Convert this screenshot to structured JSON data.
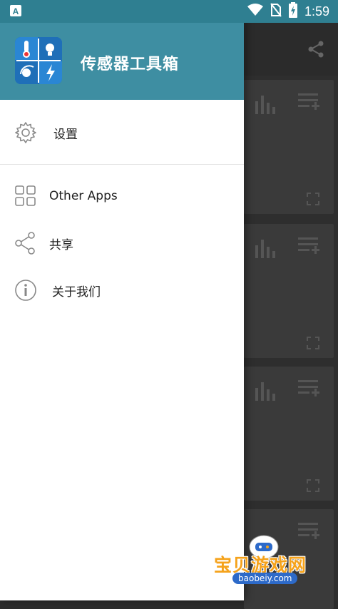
{
  "status_bar": {
    "time": "1:59",
    "icons": [
      "notification-a-icon",
      "wifi-icon",
      "no-sim-icon",
      "battery-charging-icon"
    ]
  },
  "drawer": {
    "app_title": "传感器工具箱",
    "menu": [
      {
        "label": "设置",
        "icon": "gear-icon"
      },
      {
        "label": "Other Apps",
        "icon": "grid-icon"
      },
      {
        "label": "共享",
        "icon": "share-icon"
      },
      {
        "label": "关于我们",
        "icon": "info-icon"
      }
    ]
  },
  "background_app": {
    "toolbar_icon": "share-icon",
    "card_icons": [
      "bar-chart-icon",
      "playlist-add-icon",
      "fullscreen-icon"
    ]
  },
  "watermark": {
    "text": "宝贝游戏网",
    "url": "baobeiy.com"
  },
  "colors": {
    "status_bar": "#2f7f91",
    "drawer_header": "#3e8ea2",
    "drawer_bg": "#ffffff",
    "scrim_bg": "#2e2e2e"
  }
}
